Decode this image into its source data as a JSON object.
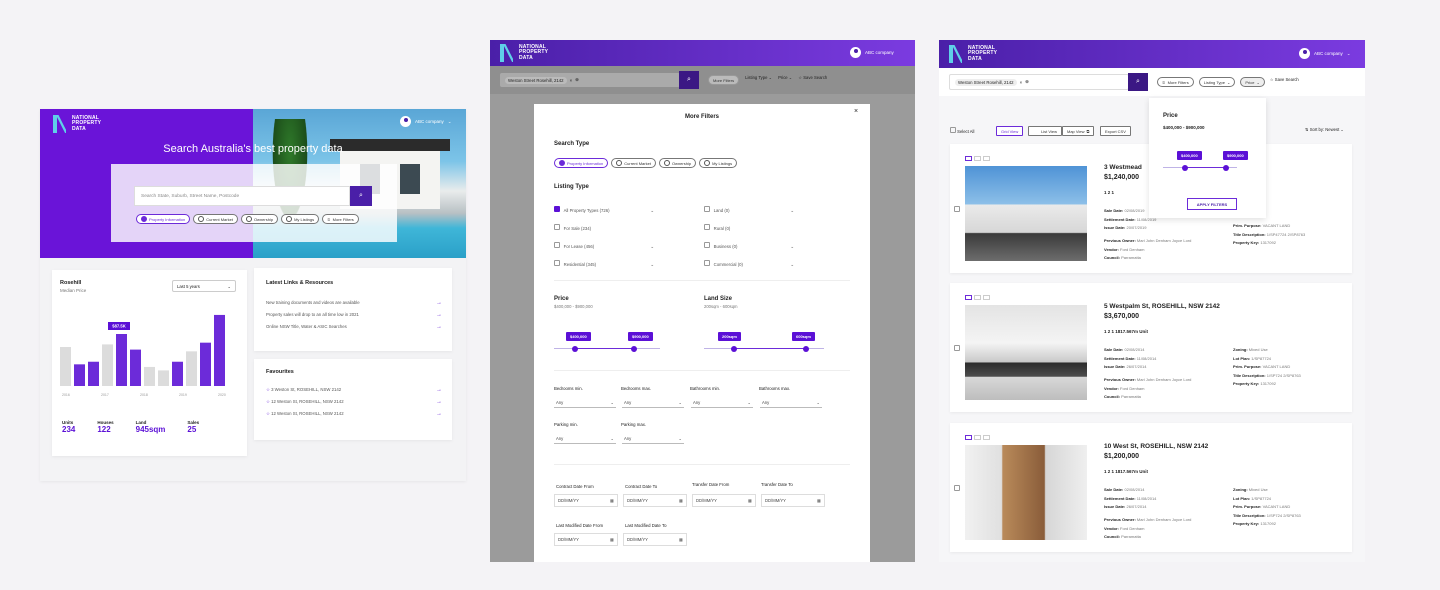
{
  "brand": {
    "logo_text": "NATIONAL PROPERTY DATA",
    "company": "ABC company",
    "accent": "#5b10d6",
    "header_gradient": [
      "#4a1fa8",
      "#7b3be0"
    ]
  },
  "p1": {
    "hero_title": "Search Australia's best property data",
    "search_placeholder": "Search State, Suburb, Street Name, Postcode",
    "tabs": [
      "Property Information",
      "Current Market",
      "Ownership",
      "My Listings",
      "More Filters"
    ],
    "chart": {
      "suburb": "Rosehill",
      "subtitle": "Median Price",
      "period": "Last 5 years",
      "highlight": "$87.5K"
    },
    "stats": [
      {
        "label": "Units",
        "value": "234"
      },
      {
        "label": "Houses",
        "value": "122"
      },
      {
        "label": "Land",
        "value": "945sqm"
      },
      {
        "label": "Sales",
        "value": "25"
      }
    ],
    "links_title": "Latest Links & Resources",
    "links": [
      "New training documents and videos are available",
      "Property sales will drop to an all time low in 2021",
      "Online NSW Title, Water & ASIC Searches"
    ],
    "fav_title": "Favourites",
    "favourites": [
      "3 Weston St, ROSEHILL, NSW 2142",
      "12 Weston St, ROSEHILL, NSW 2142",
      "12 Weston St, ROSEHILL, NSW 2142"
    ]
  },
  "chart_data": {
    "type": "bar",
    "title": "Rosehill",
    "subtitle": "Median Price",
    "categories": [
      "2016",
      "2016",
      "2016",
      "2017",
      "2017",
      "2017",
      "2018",
      "2018",
      "2018",
      "2019",
      "2019",
      "2020"
    ],
    "x_tick_labels": [
      "2016",
      "2017",
      "2018",
      "2019",
      "2020"
    ],
    "values": [
      45,
      25,
      28,
      48,
      60,
      42,
      22,
      18,
      28,
      40,
      50,
      82
    ],
    "highlight_value": "$87.5K",
    "colors": {
      "highlight": "#6c2bd9",
      "muted": "#dcdcdc"
    },
    "highlighted_indices": [
      1,
      2,
      4,
      5,
      8,
      10,
      11
    ],
    "ylim": [
      0,
      90
    ]
  },
  "p2": {
    "search_value": "Weston Street Rosehill, 2142",
    "toolbar": [
      "More Filters",
      "Listing Type",
      "Price",
      "Save Search"
    ],
    "modal_title": "More Filters",
    "search_type_title": "Search Type",
    "search_types": [
      "Property Information",
      "Current Market",
      "Ownership",
      "My Listings"
    ],
    "listing_type_title": "Listing Type",
    "listing_left": [
      "All Property Types  (726)",
      "For Sale  (234)",
      "For Lease  (456)",
      "Residential  (345)"
    ],
    "listing_right": [
      "Land  (0)",
      "Rural  (0)",
      "Business  (0)",
      "Commercial (0)"
    ],
    "price_title": "Price",
    "price_range": "$400,000 - $900,000",
    "price_min": "$400,000",
    "price_max": "$900,000",
    "land_title": "Land Size",
    "land_range": "200sqm - 600sqm",
    "land_min": "200sqm",
    "land_max": "600sqm",
    "price_fraction": [
      0.2,
      0.75
    ],
    "land_fraction": [
      0.25,
      0.85
    ],
    "rooms": [
      "Bedrooms min.",
      "Bedrooms max.",
      "Bathrooms min.",
      "Bathrooms max.",
      "Parking min.",
      "Parking max."
    ],
    "any": "Any",
    "dates": [
      "Contract Date From",
      "Contract Date To",
      "Transfer Date From",
      "Transfer Date To",
      "Last Modified Date From",
      "Last Modified Date To"
    ],
    "date_placeholder": "DD/MM/YY"
  },
  "p3": {
    "search_value": "Weston Street Rosehill, 2142",
    "toolbar": [
      "More Filters",
      "Listing Type",
      "Price",
      "Save Search"
    ],
    "select_all": "Select All",
    "views": [
      "Grid View",
      "List View",
      "Map View"
    ],
    "export": "Export CSV",
    "sort": "Sort by: Newest",
    "price_popup": {
      "title": "Price",
      "range": "$400,000 - $900,000",
      "min": "$400,000",
      "max": "$900,000",
      "apply": "APPLY FILTERS",
      "fraction": [
        0.3,
        0.85
      ]
    },
    "listings": [
      {
        "address": "3 Westmead",
        "price": "$1,240,000",
        "feats": "1  2  1",
        "dates": [
          "Sale Date:",
          "Settlement Date:",
          "Issue Date:"
        ],
        "datevals": [
          "02/08/2019",
          "11/08/2019",
          "20/07/2019"
        ],
        "owners": [
          "Previous Owner:",
          "Vendor:",
          "Council:"
        ],
        "ownervals": [
          "Mari John Denham Joyce Lord",
          "Ford Denham",
          "Parramatta"
        ],
        "right": [
          "Prim. Purpose:",
          "Title Description:",
          "Property Key:"
        ],
        "rightvals": [
          "VACANT LAND",
          "1/SP47724 2/SP8763",
          "1317092"
        ]
      },
      {
        "address": "5 Westpalm St, ROSEHILL, NSW 2142",
        "price": "$3,670,000",
        "feats": "1  2  1  1817.567m  Unit",
        "dates": [
          "Sale Date:",
          "Settlement Date:",
          "Issue Date:"
        ],
        "datevals": [
          "02/08/2014",
          "11/08/2014",
          "26/07/2014"
        ],
        "owners": [
          "Previous Owner:",
          "Vendor:",
          "Council:"
        ],
        "ownervals": [
          "Mari John Denham Joyce Lord",
          "Ford Denham",
          "Parramatta"
        ],
        "right": [
          "Zoning:",
          "Lot Plan:",
          "Prim. Purpose:",
          "Title Description:",
          "Property Key:"
        ],
        "rightvals": [
          "Mixed Use",
          "1/SP87724",
          "VACANT LAND",
          "1/SP724 2/SP8763",
          "1317092"
        ]
      },
      {
        "address": "10 West St, ROSEHILL, NSW 2142",
        "price": "$1,200,000",
        "feats": "1  2  1  1817.567m  Unit",
        "dates": [
          "Sale Date:",
          "Settlement Date:",
          "Issue Date:"
        ],
        "datevals": [
          "02/08/2014",
          "11/08/2014",
          "26/07/2014"
        ],
        "owners": [
          "Previous Owner:",
          "Vendor:",
          "Council:"
        ],
        "ownervals": [
          "Mari John Denham Joyce Lord",
          "Ford Denham",
          "Parramatta"
        ],
        "right": [
          "Zoning:",
          "Lot Plan:",
          "Prim. Purpose:",
          "Title Description:",
          "Property Key:"
        ],
        "rightvals": [
          "Mixed Use",
          "1/SP87724",
          "VACANT LAND",
          "1/SP724 2/SP8763",
          "1317092"
        ]
      }
    ]
  }
}
